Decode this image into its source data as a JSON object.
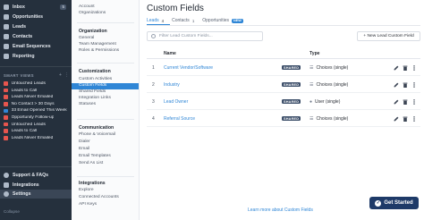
{
  "nav": {
    "items": [
      {
        "label": "Inbox",
        "count": "5"
      },
      {
        "label": "Opportunities",
        "count": ""
      },
      {
        "label": "Leads",
        "count": ""
      },
      {
        "label": "Contacts",
        "count": ""
      },
      {
        "label": "Email Sequences",
        "count": ""
      },
      {
        "label": "Reporting",
        "count": ""
      }
    ],
    "smart_views_heading": "SMART VIEWS",
    "smart_views": [
      {
        "label": "Untouched Leads",
        "color": "#e6554e"
      },
      {
        "label": "Leads to Call",
        "color": "#e6554e"
      },
      {
        "label": "Leads Never Emailed",
        "color": "#e6554e"
      },
      {
        "label": "No Contact > 30 Days",
        "color": "#e6554e"
      },
      {
        "label": "33 Email Opened This Week",
        "color": "#2f86d6"
      },
      {
        "label": "Opportunity Follow-up",
        "color": "#e6554e"
      },
      {
        "label": "Untouched Leads",
        "color": "#e6554e"
      },
      {
        "label": "Leads to Call",
        "color": "#e6554e"
      },
      {
        "label": "Leads Never Emailed",
        "color": "#e6554e"
      }
    ],
    "bottom_items": [
      {
        "label": "Support & FAQs"
      },
      {
        "label": "Integrations"
      },
      {
        "label": "Settings"
      }
    ],
    "collapse_label": "Collapse"
  },
  "settings_menu": {
    "top_items": [
      "Account",
      "Organizations"
    ],
    "sections": [
      {
        "heading": "Organization",
        "items": [
          "General",
          "Team Management",
          "Roles & Permissions"
        ]
      },
      {
        "heading": "Customization",
        "items": [
          "Custom Activities",
          "Custom Fields",
          "Shared Fields",
          "Integration Links",
          "Statuses"
        ]
      },
      {
        "heading": "Communication",
        "items": [
          "Phone & Voicemail",
          "Dialer",
          "Email",
          "Email Templates",
          "Send As List"
        ]
      },
      {
        "heading": "Integrations",
        "items": [
          "Explore",
          "Connected Accounts",
          "API Keys"
        ]
      }
    ],
    "active_item": "Custom Fields"
  },
  "main": {
    "title": "Custom Fields",
    "tabs": [
      {
        "label": "Leads",
        "count": "4"
      },
      {
        "label": "Contacts",
        "count": "1"
      },
      {
        "label": "Opportunities",
        "badge": "NEW"
      }
    ],
    "filter_placeholder": "Filter Lead Custom Fields...",
    "new_button": "+ New Lead Custom Field",
    "columns": {
      "name": "Name",
      "type": "Type"
    },
    "rows": [
      {
        "num": "1",
        "name": "Current Vendor/Software",
        "shared": "SHARED",
        "type": "Choices (single)",
        "type_icon": "list-icon"
      },
      {
        "num": "2",
        "name": "Industry",
        "shared": "SHARED",
        "type": "Choices (single)",
        "type_icon": "list-icon"
      },
      {
        "num": "3",
        "name": "Lead Owner",
        "shared": "SHARED",
        "type": "User (single)",
        "type_icon": "user-icon"
      },
      {
        "num": "4",
        "name": "Referral Source",
        "shared": "SHARED",
        "type": "Choices (single)",
        "type_icon": "list-icon"
      }
    ],
    "learn_more": "Learn more about Custom Fields",
    "get_started": "Get Started"
  },
  "colors": {
    "accent": "#2f86d6",
    "nav_bg": "#25303d",
    "cta": "#1e3a68"
  }
}
